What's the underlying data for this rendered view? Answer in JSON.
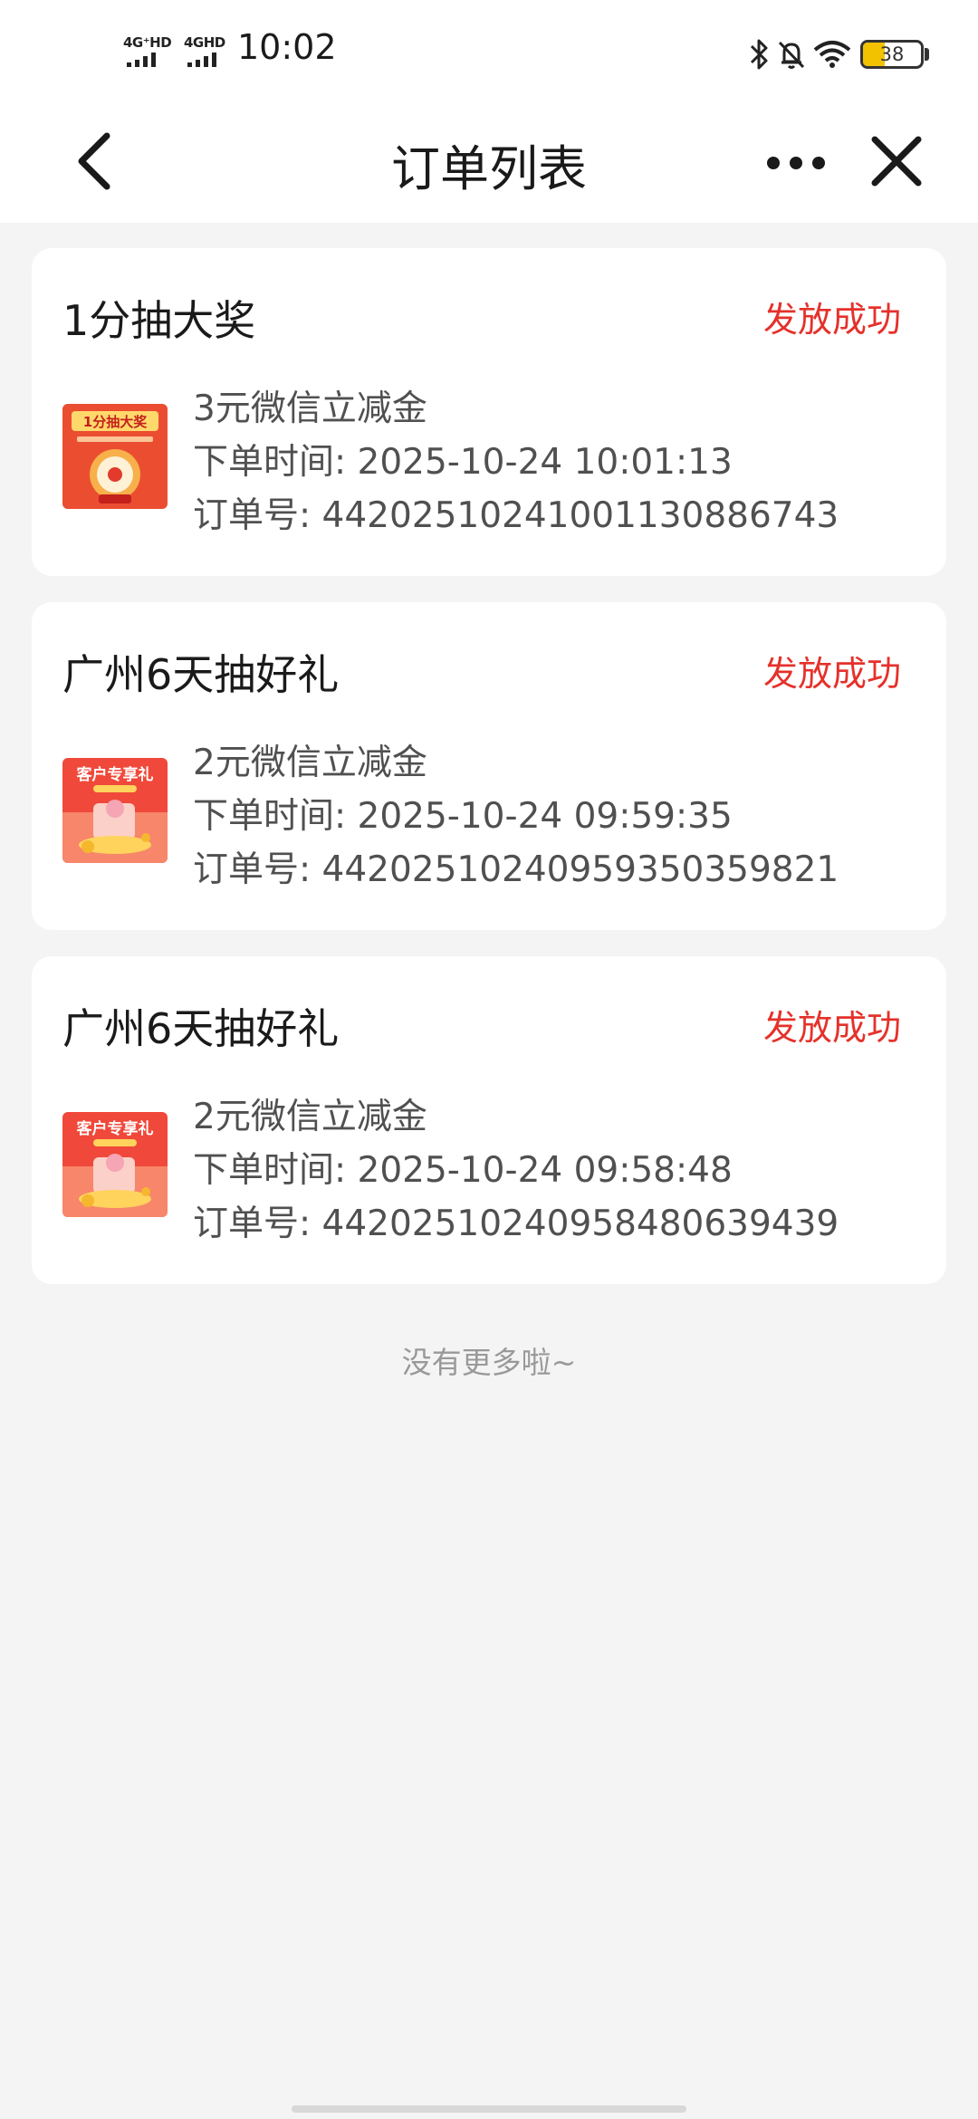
{
  "status_bar": {
    "network1": "4G⁺HD",
    "network2": "4GHD",
    "time": "10:02",
    "battery": "38",
    "battery_level": 0.38,
    "icons": [
      "bluetooth-icon",
      "bell-off-icon",
      "wifi-icon",
      "battery-icon"
    ]
  },
  "navbar": {
    "title": "订单列表",
    "icons": [
      "back-arrow-icon",
      "more-dots-icon",
      "close-icon"
    ]
  },
  "orders": [
    {
      "title": "1分抽大奖",
      "status": "发放成功",
      "product": "3元微信立减金",
      "time_label": "下单时间: ",
      "time": "2025-10-24 10:01:13",
      "order_label": "订单号: ",
      "order_no": "4420251024100113088674 3",
      "thumb_text": "1分抽大奖"
    },
    {
      "title": "广州6天抽好礼",
      "status": "发放成功",
      "product": "2元微信立减金",
      "time_label": "下单时间: ",
      "time": "2025-10-24 09:59:35",
      "order_label": "订单号: ",
      "order_no": "44202510240959350359821",
      "thumb_text": "客户专享礼"
    },
    {
      "title": "广州6天抽好礼",
      "status": "发放成功",
      "product": "2元微信立减金",
      "time_label": "下单时间: ",
      "time": "2025-10-24 09:58:48",
      "order_label": "订单号: ",
      "order_no": "44202510240958480639439",
      "thumb_text": "客户专享礼"
    }
  ],
  "footer": {
    "no_more": "没有更多啦~"
  },
  "colors": {
    "status_success": "#e5312b",
    "background": "#f4f4f4",
    "card": "#ffffff"
  }
}
